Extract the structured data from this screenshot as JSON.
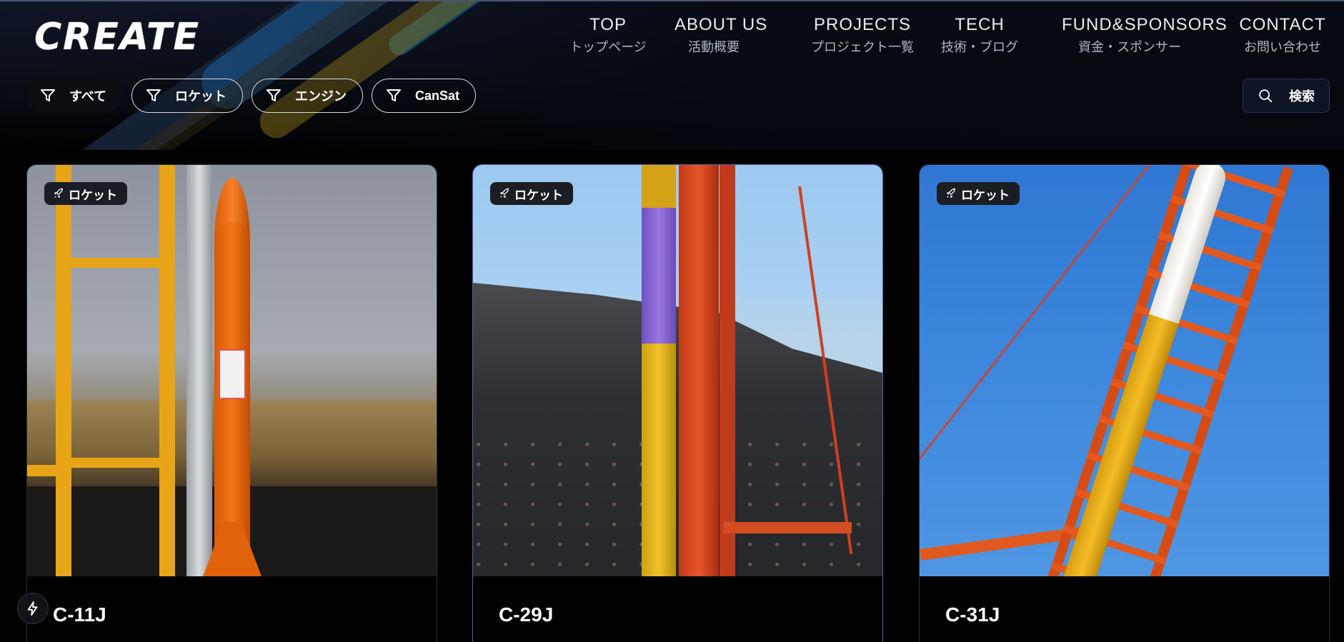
{
  "brand": {
    "logo_text": "CREATE"
  },
  "nav": [
    {
      "en": "TOP",
      "ja": "トップページ"
    },
    {
      "en": "ABOUT US",
      "ja": "活動概要"
    },
    {
      "en": "PROJECTS",
      "ja": "プロジェクト一覧"
    },
    {
      "en": "TECH",
      "ja": "技術・ブログ"
    },
    {
      "en": "FUND&SPONSORS",
      "ja": "資金・スポンサー"
    },
    {
      "en": "CONTACT",
      "ja": "お問い合わせ"
    }
  ],
  "filters": [
    {
      "label": "すべて",
      "icon": "filter-icon",
      "active": true
    },
    {
      "label": "ロケット",
      "icon": "filter-icon",
      "active": false
    },
    {
      "label": "エンジン",
      "icon": "filter-icon",
      "active": false
    },
    {
      "label": "CanSat",
      "icon": "filter-icon",
      "active": false
    }
  ],
  "search": {
    "label": "検索",
    "icon": "search-icon"
  },
  "cards": [
    {
      "tag": "ロケット",
      "tag_icon": "rocket-icon",
      "title": "C-11J"
    },
    {
      "tag": "ロケット",
      "tag_icon": "rocket-icon",
      "title": "C-29J"
    },
    {
      "tag": "ロケット",
      "tag_icon": "rocket-icon",
      "title": "C-31J"
    }
  ],
  "fab": {
    "icon": "lightning-icon"
  },
  "colors": {
    "accent_border": "#5464a8",
    "background": "#000000",
    "tag_bg": "#1a1d24"
  }
}
